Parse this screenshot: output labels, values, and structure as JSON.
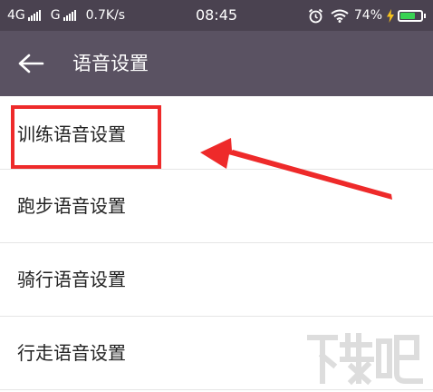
{
  "status_bar": {
    "network1": "4G",
    "network2": "G",
    "speed": "0.7K/s",
    "time": "08:45",
    "battery_percent": "74%",
    "battery_level": 0.74,
    "icons": [
      "signal-icon",
      "signal-icon",
      "alarm-icon",
      "wifi-icon",
      "charging-icon",
      "battery-icon"
    ]
  },
  "app_bar": {
    "title": "语音设置",
    "back_icon": "back-arrow-icon"
  },
  "list": {
    "items": [
      {
        "label": "训练语音设置"
      },
      {
        "label": "跑步语音设置"
      },
      {
        "label": "骑行语音设置"
      },
      {
        "label": "行走语音设置"
      }
    ]
  },
  "annotation": {
    "color": "#ee2a2a",
    "highlighted_item": "训练语音设置"
  },
  "colors": {
    "status_bar": "#4a4250",
    "app_bar": "#5a5262",
    "battery": "#39d353",
    "charge_bolt": "#f6c21c"
  }
}
